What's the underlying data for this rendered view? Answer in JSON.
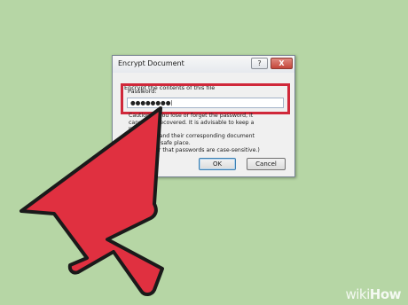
{
  "dialog": {
    "title": "Encrypt Document",
    "help_label": "?",
    "close_label": "X",
    "legend": "Encrypt the contents of this file",
    "password_label": "Password:",
    "password_value": "●●●●●●●●",
    "caution_lines": [
      "Caution: If you lose or forget the password, it",
      "cannot be recovered. It is advisable to keep a list of",
      "passwords and their corresponding document",
      "names in a safe place.",
      "(Remember that passwords are case-sensitive.)"
    ],
    "ok_label": "OK",
    "cancel_label": "Cancel"
  },
  "overlay": {
    "highlight_color": "#d0283a",
    "arrow_color": "#e03040",
    "arrow_icon": "big-pointer-arrow-icon"
  },
  "watermark": {
    "prefix": "wiki",
    "suffix": "How"
  }
}
